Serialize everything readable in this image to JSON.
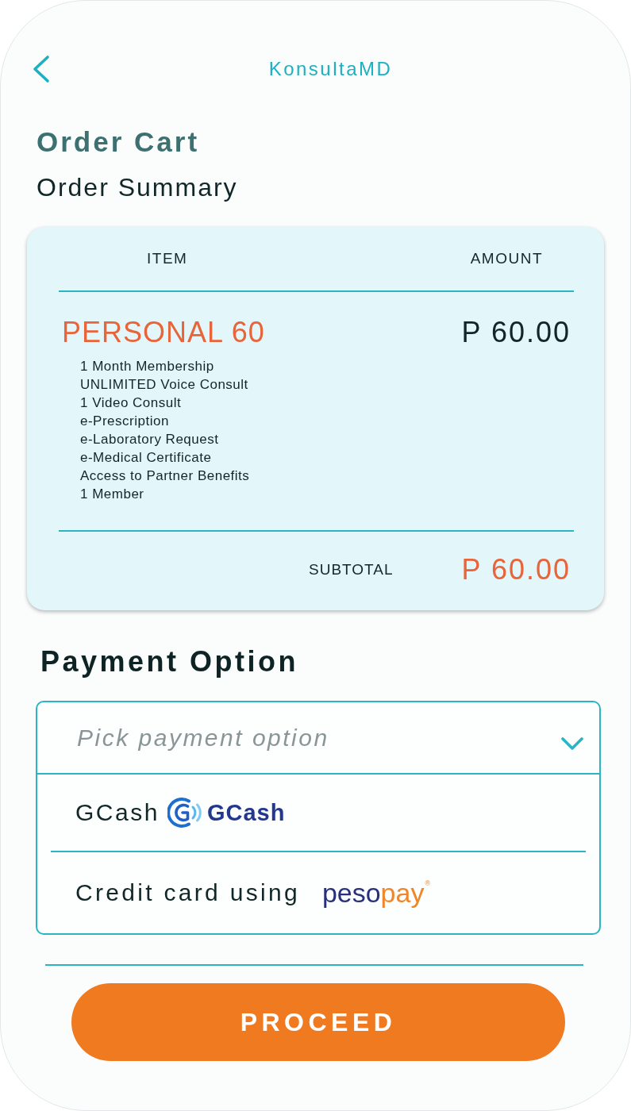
{
  "header": {
    "title": "KonsultaMD"
  },
  "page": {
    "title": "Order Cart",
    "subtitle": "Order Summary"
  },
  "order_summary": {
    "columns": [
      "ITEM",
      "AMOUNT"
    ],
    "items": [
      {
        "name": "PERSONAL 60",
        "amount": "P 60.00",
        "features": [
          "1 Month Membership",
          "UNLIMITED Voice Consult",
          "1 Video Consult",
          "e-Prescription",
          "e-Laboratory Request",
          "e-Medical Certificate",
          "Access to Partner Benefits",
          "1 Member"
        ]
      }
    ],
    "subtotal": {
      "label": "SUBTOTAL",
      "amount": "P 60.00"
    }
  },
  "payment": {
    "title": "Payment Option",
    "dropdown": {
      "placeholder": "Pick payment option",
      "expanded": true,
      "options": [
        {
          "kind": "gcash",
          "label": "GCash",
          "selected": false,
          "logo": [
            "GCash"
          ]
        },
        {
          "kind": "pesopay",
          "label": "Credit card using",
          "selected": false,
          "logo": [
            "peso",
            "pay",
            "®"
          ]
        }
      ]
    }
  },
  "proceed_button": {
    "label": "PROCEED"
  }
}
